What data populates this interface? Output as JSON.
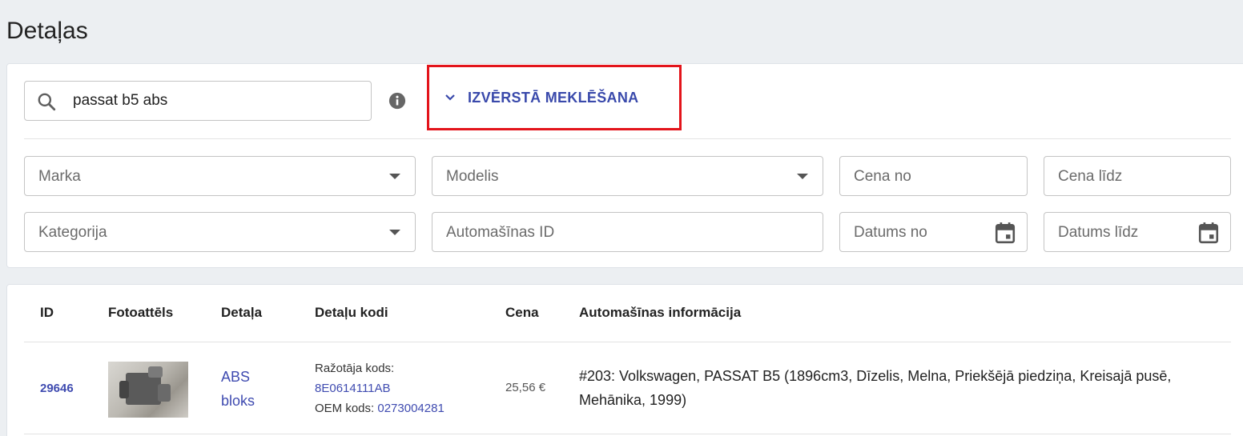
{
  "page": {
    "title": "Detaļas"
  },
  "search": {
    "value": "passat b5 abs"
  },
  "advanced": {
    "label": "IZVĒRSTĀ MEKLĒŠANA",
    "highlight_color": "#e3141b"
  },
  "filters": {
    "marka": "Marka",
    "modelis": "Modelis",
    "cena_no": "Cena no",
    "cena_lidz": "Cena līdz",
    "kategorija": "Kategorija",
    "auto_id": "Automašīnas ID",
    "datums_no": "Datums no",
    "datums_lidz": "Datums līdz"
  },
  "table": {
    "columns": [
      "ID",
      "Fotoattēls",
      "Detaļa",
      "Detaļu kodi",
      "Cena",
      "Automašīnas informācija"
    ],
    "rows": [
      {
        "id": "29646",
        "part_line1": "ABS",
        "part_line2": "bloks",
        "manufacturer_label": "Ražotāja kods:",
        "manufacturer_code": "8E0614111AB",
        "oem_label": "OEM kods:",
        "oem_code": "0273004281",
        "price": "25,56 €",
        "car_info": "#203: Volkswagen, PASSAT B5 (1896cm3, Dīzelis, Melna, Priekšējā piedziņa, Kreisajā pusē, Mehānika, 1999)"
      }
    ]
  },
  "colors": {
    "accent": "#3f4bb0",
    "background": "#eceff2"
  }
}
